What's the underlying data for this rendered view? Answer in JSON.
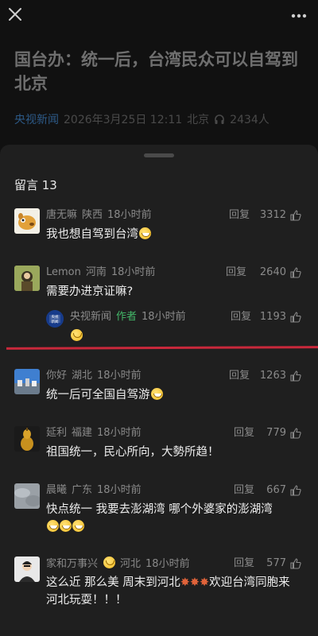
{
  "article": {
    "title": "国台办：统一后，台湾民众可以自驾到北京",
    "source": "央视新闻",
    "datetime": "2026年3月25日 12:11",
    "location": "北京",
    "listeners": "2434人"
  },
  "comments_header": {
    "label": "留言 13"
  },
  "reply_label": "回复",
  "comments": [
    {
      "nickname": "唐无嘛",
      "location": "陕西",
      "time": "18小时前",
      "likes": "3312",
      "text": "我也想自驾到台湾"
    },
    {
      "nickname": "Lemon",
      "location": "河南",
      "time": "18小时前",
      "likes": "2640",
      "text": "需要办进京证嘛?"
    },
    {
      "nickname": "央视新闻",
      "author_tag": "作者",
      "time": "18小时前",
      "likes": "1193",
      "text": ""
    },
    {
      "nickname": "你好",
      "location": "湖北",
      "time": "18小时前",
      "likes": "1263",
      "text": "统一后可全国自驾游"
    },
    {
      "nickname": "延利",
      "location": "福建",
      "time": "18小时前",
      "likes": "779",
      "text": "祖国统一，民心所向，大勢所趋！"
    },
    {
      "nickname": "晨曦",
      "location": "广东",
      "time": "18小时前",
      "likes": "667",
      "text": "快点统一   我要去澎湖湾   哪个外婆家的澎湖湾"
    },
    {
      "nickname": "家和万事兴",
      "location": "河北",
      "time": "18小时前",
      "likes": "577",
      "text": "这么近 那么美 周末到河北",
      "text2": "欢迎台湾同胞来河北玩耍！！！"
    }
  ],
  "colors": {
    "accent_green": "#43b768",
    "annotation_red": "#c9283b",
    "source_blue": "#2d5a88"
  },
  "icons": [
    "close-icon",
    "more-icon",
    "headphone-icon",
    "thumbs-up-icon"
  ]
}
